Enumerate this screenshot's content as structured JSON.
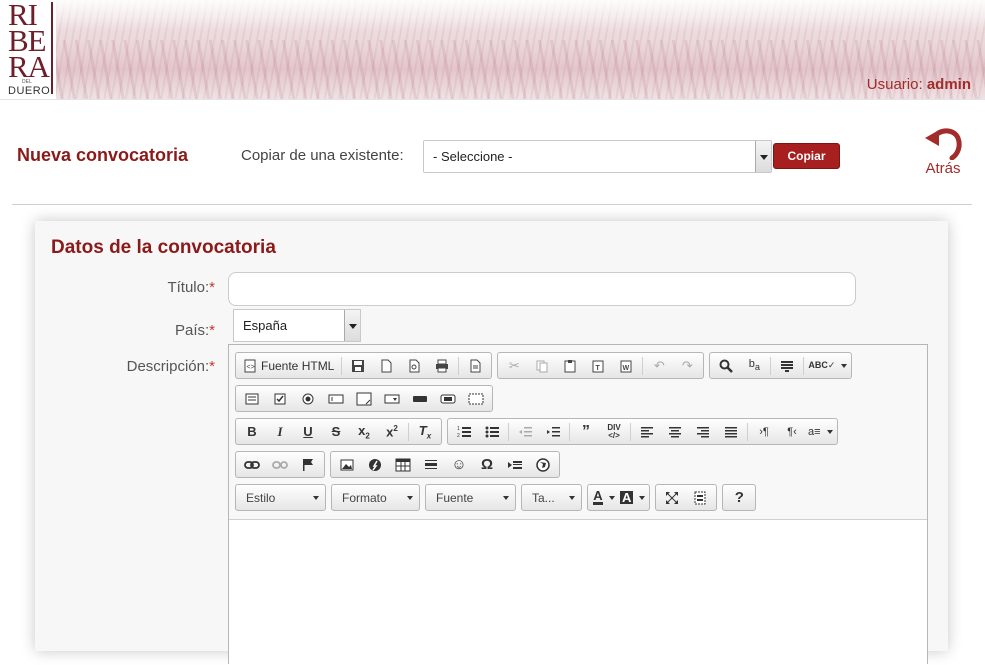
{
  "header": {
    "logo": {
      "line1": "RI",
      "line2": "BE",
      "line3": "RA",
      "small": "DEL",
      "bottom": "DUERO"
    },
    "user_label": "Usuario:",
    "user_name": "admin"
  },
  "page": {
    "title": "Nueva convocatoria",
    "copy_label": "Copiar de una existente:",
    "copy_select_value": "- Seleccione -",
    "copy_button": "Copiar",
    "back_label": "Atrás"
  },
  "form": {
    "section_title": "Datos de la convocatoria",
    "titulo_label": "Título:",
    "pais_label": "País:",
    "pais_value": "España",
    "descripcion_label": "Descripción:",
    "required_mark": "*"
  },
  "editor": {
    "source_button": "Fuente HTML",
    "style_combo": "Estilo",
    "format_combo": "Formato",
    "font_combo": "Fuente",
    "size_combo": "Ta...",
    "help_button": "?"
  },
  "colors": {
    "accent": "#8b1a1a",
    "button": "#a71f1f",
    "link": "#a22c2c"
  }
}
